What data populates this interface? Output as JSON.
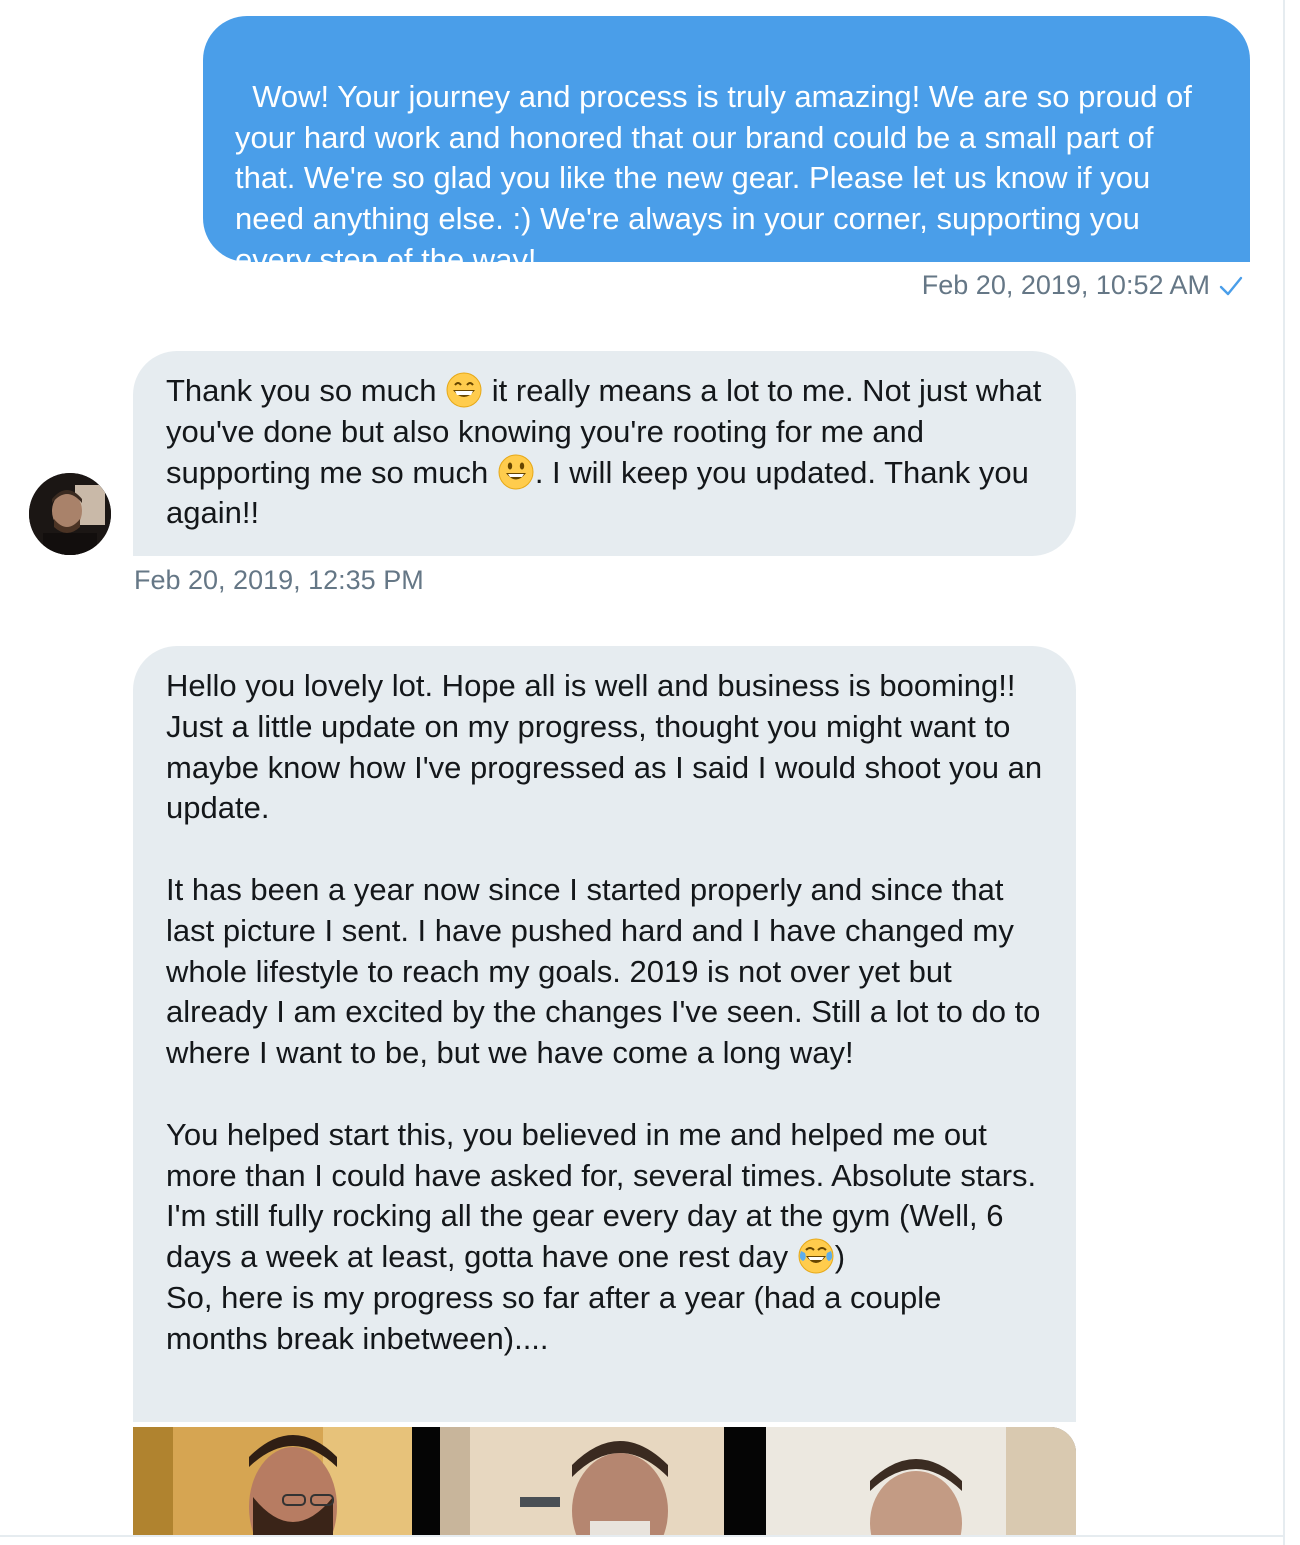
{
  "messages": {
    "outgoing": {
      "text": "Wow! Your journey and process is truly amazing! We are so proud of your hard work and honored that our brand could be a small part of that. We're so glad you like the new gear. Please let us know if you need anything else. :) We're always in your corner, supporting you every step of the way!",
      "timestamp": "Feb 20, 2019, 10:52 AM"
    },
    "incoming_1": {
      "part1": "Thank you so much ",
      "emoji1": "grinning-smiling-eyes-emoji",
      "part2": " it really means a lot to me. Not just what you've done but also knowing you're rooting for me and supporting me so much ",
      "emoji2": "smiley-emoji",
      "part3": ". I will keep you updated. Thank you again!!",
      "timestamp": "Feb 20, 2019, 12:35 PM"
    },
    "incoming_2": {
      "para1": "Hello you lovely lot. Hope all is well and business is booming!! Just a little update on my progress, thought you might want to maybe know how I've progressed as I said I would shoot you an update.",
      "para2": "It has been a year now since I started properly and since that last picture I sent. I have pushed hard and I have changed my whole lifestyle to reach my goals. 2019 is not over yet but already I am excited by the changes I've seen. Still a lot to do to where I want to be, but we have come a long way!",
      "para3a": "You helped start this, you believed in me and helped me out more than I could have asked for, several times. Absolute stars. I'm still fully rocking all the gear every day at the gym (Well, 6 days a week at least, gotta have one rest day ",
      "emoji3": "tears-of-joy-emoji",
      "para3b": ")\nSo, here is my progress so far after a year (had a couple months break inbetween)...."
    }
  },
  "colors": {
    "outgoing_bubble": "#4a9ee9",
    "incoming_bubble": "#e6ecf0",
    "timestamp": "#657786",
    "read_check": "#4a9ee9"
  },
  "icons": [
    "check-icon",
    "avatar",
    "grinning-smiling-eyes-emoji",
    "smiley-emoji",
    "tears-of-joy-emoji"
  ]
}
